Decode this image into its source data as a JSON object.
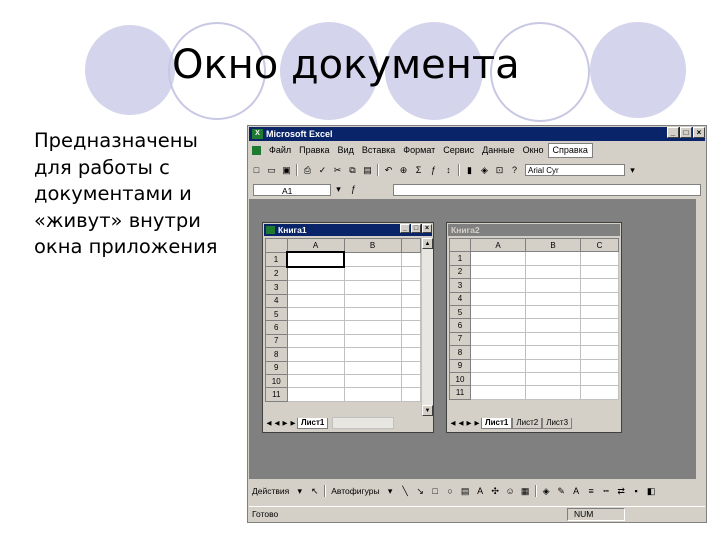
{
  "slide": {
    "title": "Окно документа",
    "body_lines": [
      "Предназначены",
      "для работы с",
      "документами и",
      "«живут» внутри",
      "окна приложения"
    ]
  },
  "app": {
    "title": "Microsoft Excel",
    "menu": [
      "Файл",
      "Правка",
      "Вид",
      "Вставка",
      "Формат",
      "Сервис",
      "Данные",
      "Окно",
      "Справка"
    ],
    "active_menu": "Справка",
    "font_name": "Arial Cyr",
    "name_box": "A1",
    "status_ready": "Готово",
    "status_num": "NUM",
    "draw_actions": "Действия",
    "draw_autoshapes": "Автофигуры"
  },
  "book1": {
    "title": "Книга1",
    "columns": [
      "A",
      "B"
    ],
    "rows": [
      "1",
      "2",
      "3",
      "4",
      "5",
      "6",
      "7",
      "8",
      "9",
      "10",
      "11"
    ],
    "sheet_tab": "Лист1"
  },
  "book2": {
    "title": "Книга2",
    "columns": [
      "A",
      "B",
      "C"
    ],
    "rows": [
      "1",
      "2",
      "3",
      "4",
      "5",
      "6",
      "7",
      "8",
      "9",
      "10",
      "11"
    ],
    "sheet_tabs": [
      "Лист1",
      "Лист2",
      "Лист3"
    ]
  },
  "colors": {
    "title_active": "#0a246a",
    "title_inactive": "#808080",
    "face": "#d4d0c8",
    "circle": "#d4d4ec"
  }
}
